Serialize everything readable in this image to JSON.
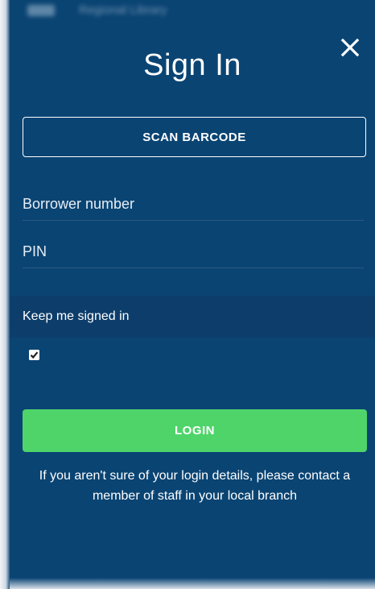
{
  "background_header": {
    "blurred_text": "Regional Library"
  },
  "dialog": {
    "title": "Sign In",
    "close_icon": "close-icon",
    "scan_button_label": "SCAN BARCODE",
    "borrower_field": {
      "value": "",
      "placeholder": "Borrower number"
    },
    "pin_field": {
      "value": "",
      "placeholder": "PIN"
    },
    "keep_signed_in": {
      "label": "Keep me signed in",
      "checked": true
    },
    "login_button_label": "LOGIN",
    "help_text": "If you aren't sure of your login details, please contact a member of staff in your local branch"
  },
  "colors": {
    "modal_background": "#0a4473",
    "keep_row_background": "#0d3e6b",
    "login_button": "#4fd46a",
    "text": "#ffffff"
  }
}
